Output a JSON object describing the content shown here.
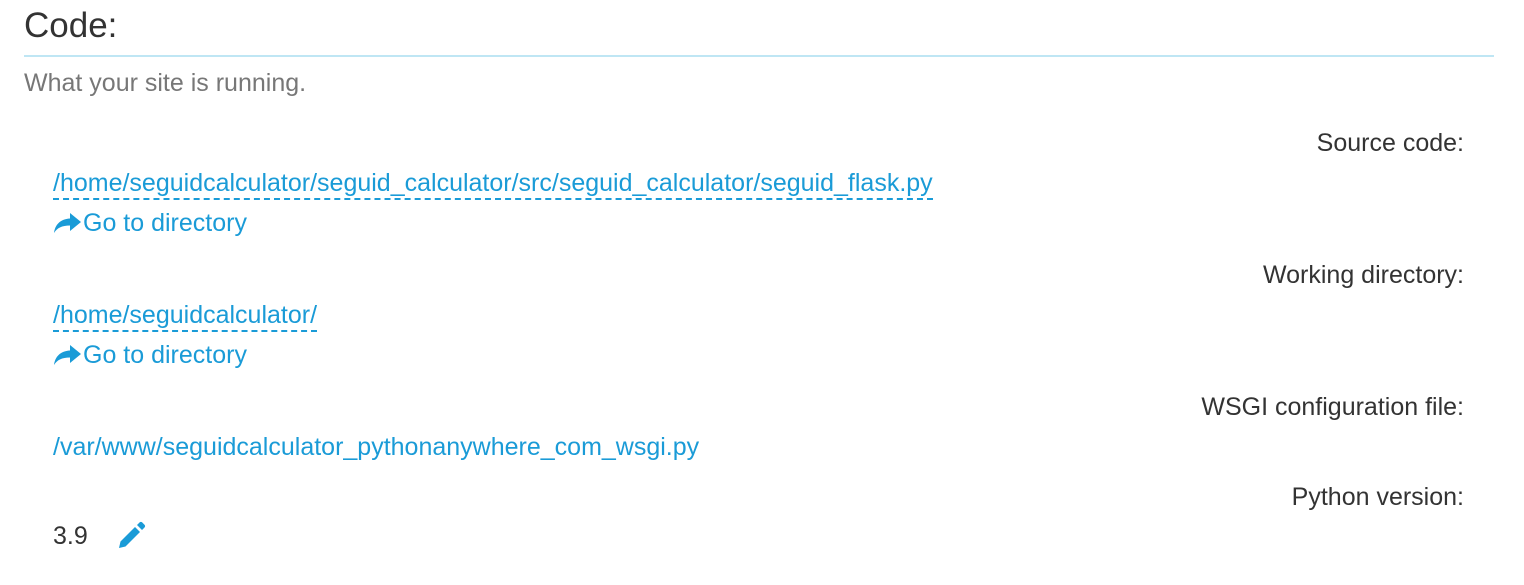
{
  "section": {
    "title": "Code:",
    "subtitle": "What your site is running."
  },
  "source_code": {
    "label": "Source code:",
    "path": "/home/seguidcalculator/seguid_calculator/src/seguid_calculator/seguid_flask.py",
    "goto_label": "Go to directory"
  },
  "working_directory": {
    "label": "Working directory:",
    "path": "/home/seguidcalculator/",
    "goto_label": "Go to directory"
  },
  "wsgi": {
    "label": "WSGI configuration file:",
    "path": "/var/www/seguidcalculator_pythonanywhere_com_wsgi.py"
  },
  "python": {
    "label": "Python version:",
    "version": "3.9",
    "edit_icon": "pencil-icon"
  },
  "colors": {
    "link": "#1a9bd7",
    "rule": "#bfe6f4",
    "text": "#333333",
    "muted": "#777777"
  }
}
